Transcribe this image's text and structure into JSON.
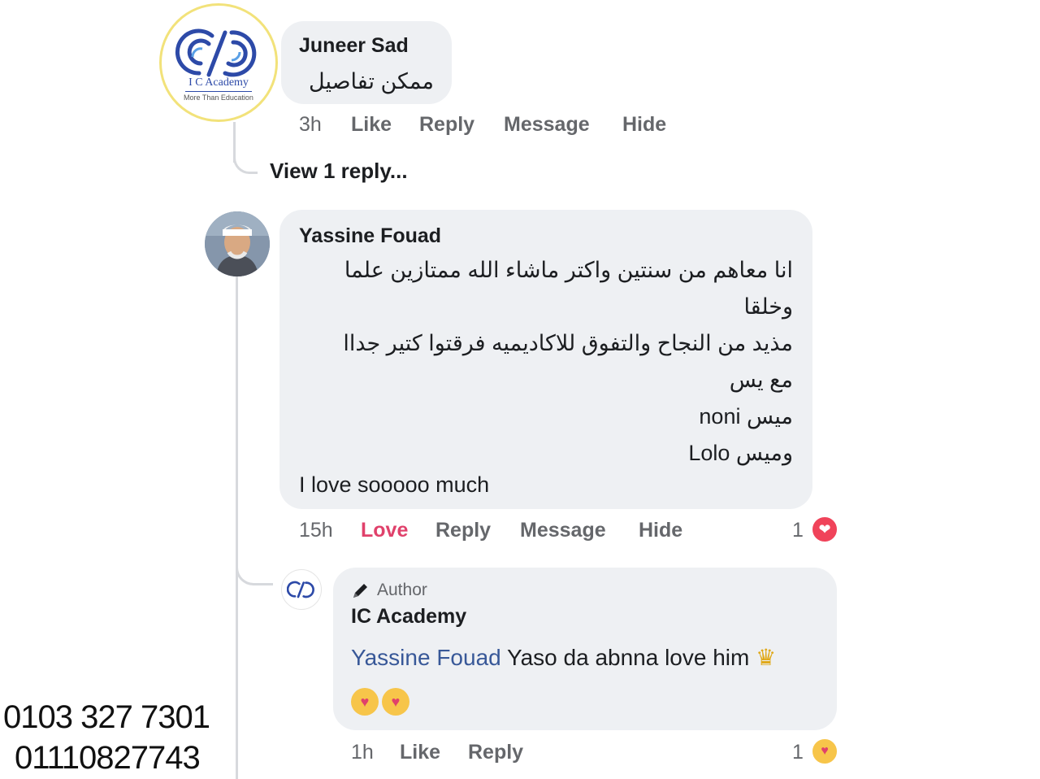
{
  "comment1": {
    "logo": {
      "name": "I C Academy",
      "tagline": "More Than Education"
    },
    "author": "Juneer Sad",
    "text": "ممكن تفاصيل",
    "time": "3h",
    "actions": {
      "like": "Like",
      "reply": "Reply",
      "message": "Message",
      "hide": "Hide"
    },
    "view_replies": "View 1 reply..."
  },
  "comment2": {
    "author": "Yassine Fouad",
    "lines": [
      "انا معاهم من سنتين واكتر ماشاء الله ممتازين علما",
      "وخلقا",
      "مذيد من النجاح والتفوق للاكاديميه فرقتوا كتير جداا",
      "مع يس",
      "ميس noni",
      "وميس Lolo"
    ],
    "last_line": "I love sooooo much",
    "time": "15h",
    "actions": {
      "love": "Love",
      "reply": "Reply",
      "message": "Message",
      "hide": "Hide"
    },
    "reaction_count": "1",
    "reaction_icon": "heart-icon"
  },
  "reply": {
    "badge": "Author",
    "author": "IC Academy",
    "mention": "Yassine Fouad",
    "text": "Yaso da abnna love him",
    "time": "1h",
    "actions": {
      "like": "Like",
      "reply": "Reply"
    },
    "reaction_count": "1",
    "reaction_icon": "care-icon"
  },
  "phones": [
    "0103 327 7301",
    "01110827743"
  ],
  "colors": {
    "bubble": "#eef0f3",
    "love": "#e0416b",
    "mention": "#385898",
    "logo_blue": "#2d4aa8"
  }
}
